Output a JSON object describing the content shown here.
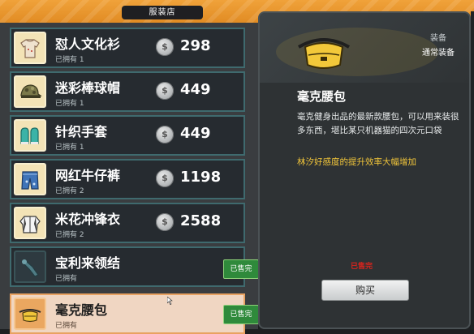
{
  "shop": {
    "title": "服装店"
  },
  "items": [
    {
      "name": "怼人文化衫",
      "owned": "已拥有 1",
      "price": "298",
      "icon": "tshirt-icon",
      "state": "owned"
    },
    {
      "name": "迷彩棒球帽",
      "owned": "已拥有 1",
      "price": "449",
      "icon": "camo-cap-icon",
      "state": "owned"
    },
    {
      "name": "针织手套",
      "owned": "已拥有 1",
      "price": "449",
      "icon": "mittens-icon",
      "state": "owned"
    },
    {
      "name": "网红牛仔裤",
      "owned": "已拥有 2",
      "price": "1198",
      "icon": "jeans-icon",
      "state": "owned"
    },
    {
      "name": "米花冲锋衣",
      "owned": "已拥有 2",
      "price": "2588",
      "icon": "jacket-icon",
      "state": "owned"
    },
    {
      "name": "宝利来领结",
      "owned": "已拥有",
      "sold_out": "已售完",
      "icon": "bowtie-icon",
      "state": "soldout"
    },
    {
      "name": "毫克腰包",
      "owned": "已拥有",
      "sold_out": "已售完",
      "icon": "waist-bag-icon",
      "state": "selected"
    }
  ],
  "detail": {
    "category": "装备",
    "subcategory": "通常装备",
    "title": "毫克腰包",
    "description": "毫克健身出品的最新款腰包，可以用来装很多东西，堪比某只机器猫的四次元口袋",
    "effect": "林汐好感度的提升效率大幅增加",
    "status": "已售完",
    "buy_label": "购买",
    "icon": "waist-bag-icon"
  },
  "colors": {
    "banner": "#e08a22",
    "row_border": "#3f6a6e",
    "sold_out_tag": "#2f8a3b",
    "effect_text": "#f2c63a",
    "sold_out_red": "#d8241d"
  }
}
